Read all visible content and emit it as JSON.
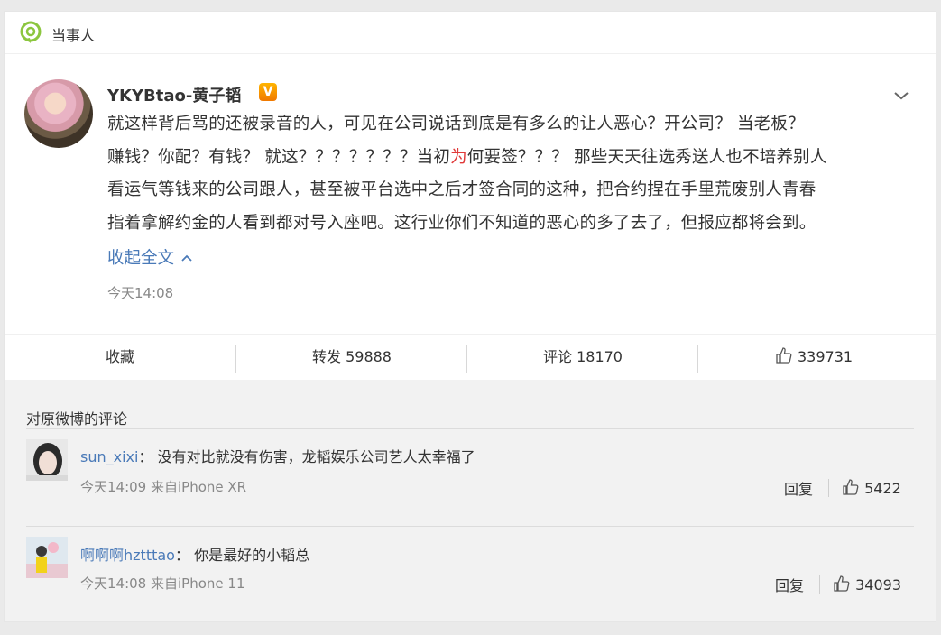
{
  "header": {
    "title": "当事人"
  },
  "post": {
    "username": "YKYBtao-黄子韬",
    "verified_badge": "V",
    "line1": "就这样背后骂的还被录音的人，可见在公司说话到底是有多么的让人恶心？开公司？ 当老板？",
    "line2_a": "赚钱？你配？有钱？ 就这？？？？？？？当初",
    "line2_red": "为",
    "line2_b": "何要签？？？ 那些天天往选秀送人也不培养别人",
    "line3": "看运气等钱来的公司跟人，甚至被平台选中之后才签合同的这种，把合约捏在手里荒废别人青春",
    "line4": "指着拿解约金的人看到都对号入座吧。这行业你们不知道的恶心的多了去了，但报应都将会到。",
    "collapse_label": "收起全文",
    "time": "今天14:08"
  },
  "actions": {
    "favorite": "收藏",
    "repost": "转发 59888",
    "comment": "评论 18170",
    "like": "339731"
  },
  "comments_section": {
    "title": "对原微博的评论",
    "reply_label": "回复",
    "items": [
      {
        "name": "sun_xixi",
        "colon": "：",
        "text": "没有对比就没有伤害，龙韬娱乐公司艺人太幸福了",
        "meta": "今天14:09 来自iPhone XR",
        "likes": "5422"
      },
      {
        "name": "啊啊啊hztttao",
        "colon": "：",
        "text": "你是最好的小韬总",
        "meta": "今天14:08 来自iPhone 11",
        "likes": "34093"
      }
    ]
  },
  "colors": {
    "link": "#4a7ab8",
    "accent_green": "#8cc63f",
    "red": "#e03a3a"
  }
}
